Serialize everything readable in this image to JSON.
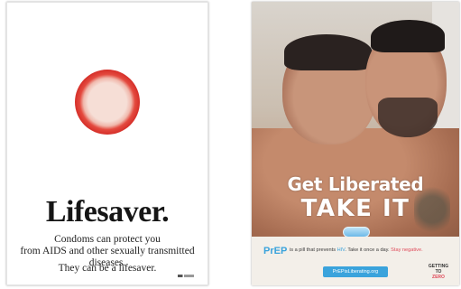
{
  "left_poster": {
    "title": "Lifesaver.",
    "body_line1": "Condoms can protect you",
    "body_line2": "from AIDS and other sexually transmitted diseases.",
    "tagline": "They can be a lifesaver."
  },
  "right_poster": {
    "headline_1": "Get Liberated",
    "headline_2": "TAKE IT",
    "prep_label": "PrEP",
    "prep_text_1": "is a pill that prevents",
    "prep_text_hiv": "HIV",
    "prep_text_2": ". Take it once a day.",
    "prep_text_neg": "Stay negative.",
    "url": "PrEPisLiberating.org",
    "getting_label": "GETTING TO",
    "zero_label": "ZERO"
  },
  "colors": {
    "condom_red": "#d6302a",
    "prep_blue": "#3aa3dc",
    "accent_pink": "#e04a5a"
  }
}
